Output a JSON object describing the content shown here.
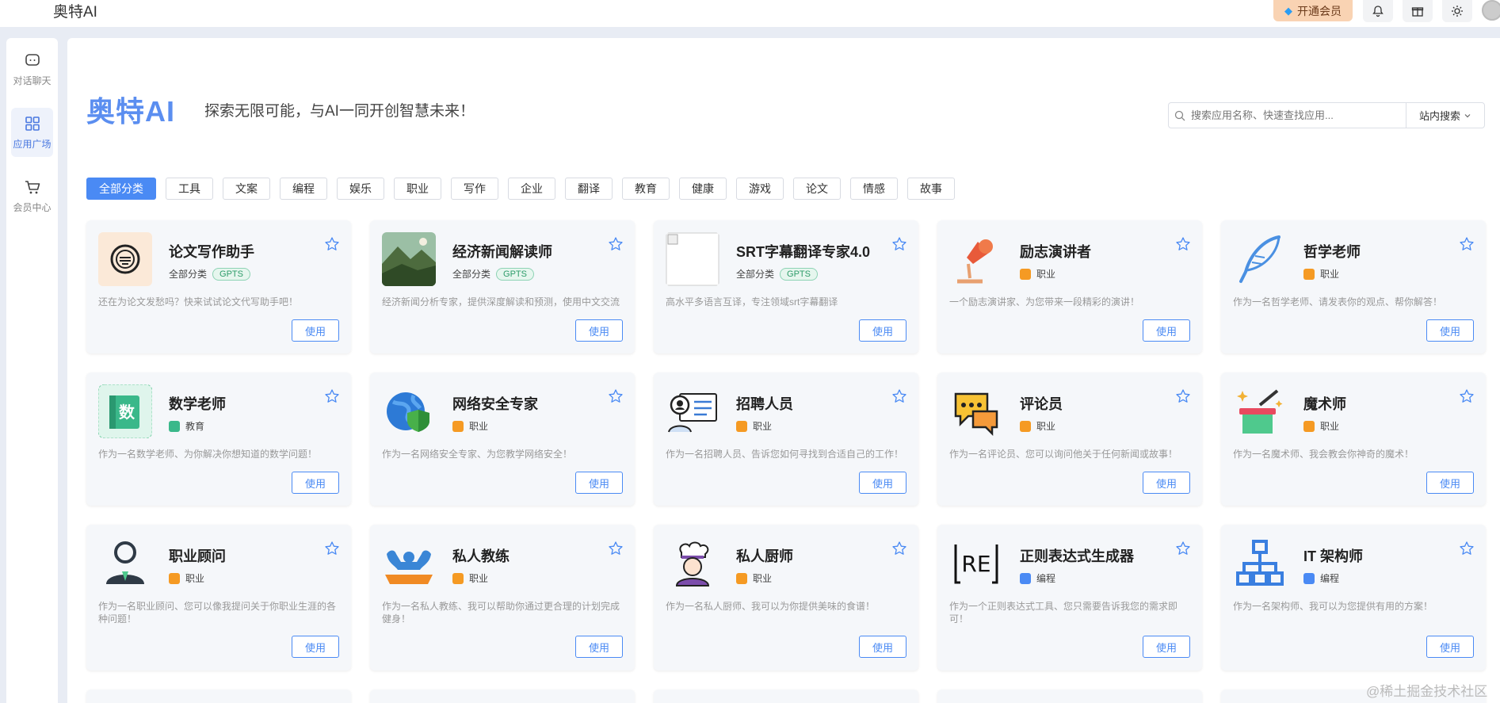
{
  "topbar": {
    "brand": "奥特AI",
    "vip_label": "开通会员",
    "icons": [
      "bell-icon",
      "gift-icon",
      "sun-icon"
    ]
  },
  "sidebar": {
    "items": [
      {
        "label": "对话聊天",
        "icon": "chat-icon",
        "active": false
      },
      {
        "label": "应用广场",
        "icon": "grid-icon",
        "active": true
      },
      {
        "label": "会员中心",
        "icon": "cart-icon",
        "active": false
      }
    ]
  },
  "header": {
    "title": "奥特AI",
    "subtitle": "探索无限可能，与AI一同开创智慧未来！"
  },
  "search": {
    "placeholder": "搜索应用名称、快速查找应用...",
    "button": "站内搜索"
  },
  "categories": [
    "全部分类",
    "工具",
    "文案",
    "编程",
    "娱乐",
    "职业",
    "写作",
    "企业",
    "翻译",
    "教育",
    "健康",
    "游戏",
    "论文",
    "情感",
    "故事"
  ],
  "active_category": "全部分类",
  "use_label": "使用",
  "cards": [
    {
      "name": "论文写作助手",
      "category": "全部分类",
      "badge": "GPTS",
      "desc": "还在为论文发愁吗？快来试试论文代写助手吧！",
      "icon": "stamp-icon"
    },
    {
      "name": "经济新闻解读师",
      "category": "全部分类",
      "badge": "GPTS",
      "desc": "经济新闻分析专家，提供深度解读和预测，使用中文交流",
      "icon": "landscape-icon"
    },
    {
      "name": "SRT字幕翻译专家4.0",
      "category": "全部分类",
      "badge": "GPTS",
      "desc": "高水平多语言互译，专注领域srt字幕翻译",
      "icon": "broken-image-icon"
    },
    {
      "name": "励志演讲者",
      "category": "职业",
      "badge": "",
      "desc": "一个励志演讲家、为您带来一段精彩的演讲！",
      "icon": "microphone-icon"
    },
    {
      "name": "哲学老师",
      "category": "职业",
      "badge": "",
      "desc": "作为一名哲学老师、请发表你的观点、帮你解答！",
      "icon": "feather-icon"
    },
    {
      "name": "数学老师",
      "category": "教育",
      "badge": "",
      "desc": "作为一名数学老师、为你解决你想知道的数学问题！",
      "icon": "math-book-icon"
    },
    {
      "name": "网络安全专家",
      "category": "职业",
      "badge": "",
      "desc": "作为一名网络安全专家、为您教学网络安全！",
      "icon": "globe-shield-icon"
    },
    {
      "name": "招聘人员",
      "category": "职业",
      "badge": "",
      "desc": "作为一名招聘人员、告诉您如何寻找到合适自己的工作！",
      "icon": "recruiter-icon"
    },
    {
      "name": "评论员",
      "category": "职业",
      "badge": "",
      "desc": "作为一名评论员、您可以询问他关于任何新闻或故事！",
      "icon": "speech-bubble-icon"
    },
    {
      "name": "魔术师",
      "category": "职业",
      "badge": "",
      "desc": "作为一名魔术师、我会教会你神奇的魔术！",
      "icon": "magic-hat-icon"
    },
    {
      "name": "职业顾问",
      "category": "职业",
      "badge": "",
      "desc": "作为一名职业顾问、您可以像我提问关于你职业生涯的各种问题！",
      "icon": "person-icon"
    },
    {
      "name": "私人教练",
      "category": "职业",
      "badge": "",
      "desc": "作为一名私人教练、我可以帮助你通过更合理的计划完成健身！",
      "icon": "muscle-icon"
    },
    {
      "name": "私人厨师",
      "category": "职业",
      "badge": "",
      "desc": "作为一名私人厨师、我可以为你提供美味的食谱！",
      "icon": "chef-icon"
    },
    {
      "name": "正则表达式生成器",
      "category": "编程",
      "badge": "",
      "desc": "作为一个正则表达式工具、您只需要告诉我您的需求即可！",
      "icon": "regex-icon"
    },
    {
      "name": "IT 架构师",
      "category": "编程",
      "badge": "",
      "desc": "作为一名架构师、我可以为您提供有用的方案！",
      "icon": "network-icon"
    }
  ],
  "watermark": "@稀土掘金技术社区"
}
